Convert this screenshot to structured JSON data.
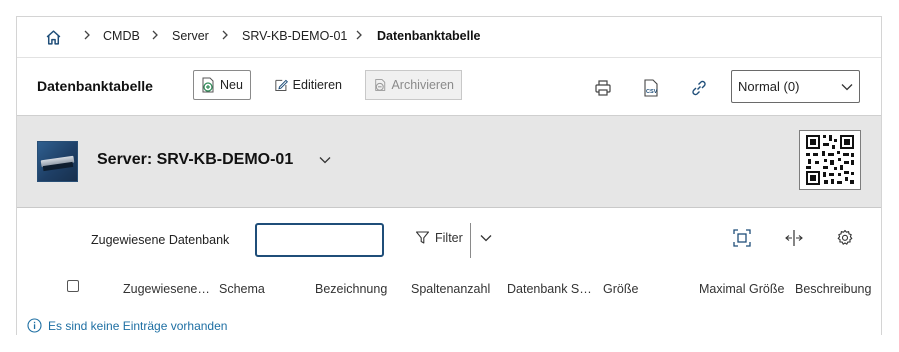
{
  "breadcrumb": {
    "home_icon": "home-icon",
    "items": [
      "CMDB",
      "Server",
      "SRV-KB-DEMO-01",
      "Datenbanktabelle"
    ]
  },
  "toolbar": {
    "title": "Datenbanktabelle",
    "new_label": "Neu",
    "edit_label": "Editieren",
    "archive_label": "Archivieren",
    "icons": [
      "print-icon",
      "csv-export-icon",
      "link-icon"
    ],
    "view_select": "Normal (0)"
  },
  "object": {
    "title": "Server: SRV-KB-DEMO-01",
    "image_icon": "server-icon",
    "qr_icon": "qr-code-icon"
  },
  "list": {
    "filter_label": "Zugewiesene Datenbank",
    "filter_value": "",
    "filter_button": "Filter",
    "columns": [
      "Zugewiesene…",
      "Schema",
      "Bezeichnung",
      "Spaltenanzahl",
      "Datenbank S…",
      "Größe",
      "Maximal Größe",
      "Beschreibung"
    ],
    "empty_message": "Es sind keine Einträge vorhanden"
  },
  "colors": {
    "accent": "#1f4e79",
    "info": "#1e6fa3",
    "header_bg": "#e6e6e6"
  }
}
